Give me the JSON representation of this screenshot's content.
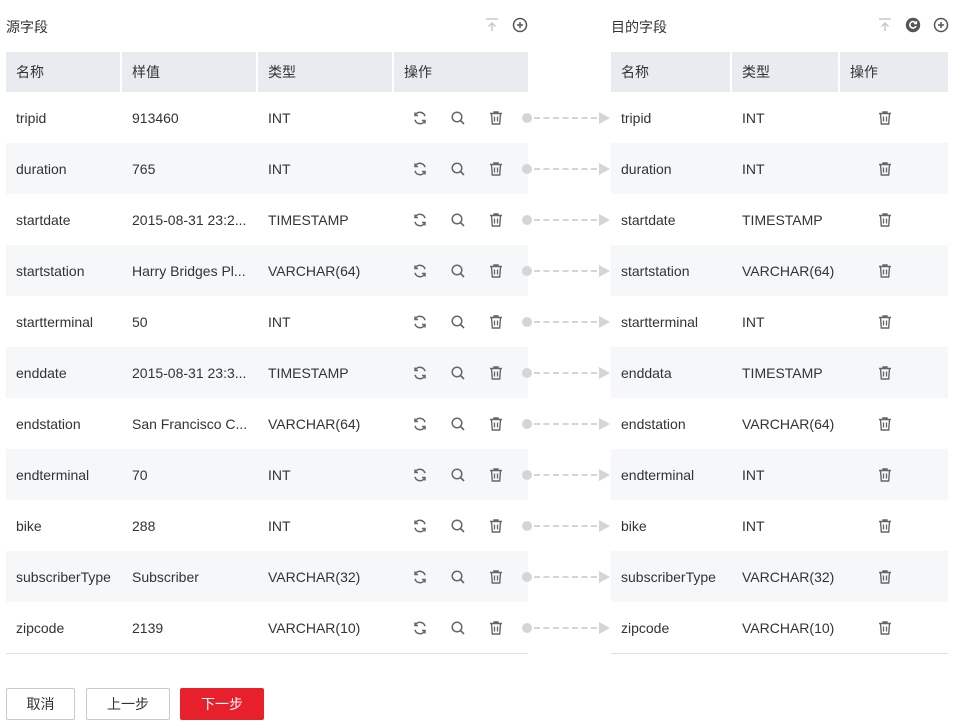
{
  "source": {
    "title": "源字段",
    "columns": [
      "名称",
      "样值",
      "类型",
      "操作"
    ],
    "rows": [
      {
        "name": "tripid",
        "sample": "913460",
        "type": "INT"
      },
      {
        "name": "duration",
        "sample": "765",
        "type": "INT"
      },
      {
        "name": "startdate",
        "sample": "2015-08-31 23:2...",
        "type": "TIMESTAMP"
      },
      {
        "name": "startstation",
        "sample": "Harry Bridges Pl...",
        "type": "VARCHAR(64)"
      },
      {
        "name": "startterminal",
        "sample": "50",
        "type": "INT"
      },
      {
        "name": "enddate",
        "sample": "2015-08-31 23:3...",
        "type": "TIMESTAMP"
      },
      {
        "name": "endstation",
        "sample": "San Francisco C...",
        "type": "VARCHAR(64)"
      },
      {
        "name": "endterminal",
        "sample": "70",
        "type": "INT"
      },
      {
        "name": "bike",
        "sample": "288",
        "type": "INT"
      },
      {
        "name": "subscriberType",
        "sample": "Subscriber",
        "type": "VARCHAR(32)"
      },
      {
        "name": "zipcode",
        "sample": "2139",
        "type": "VARCHAR(10)"
      }
    ],
    "header_icons": [
      "move-top-icon",
      "add-circle-icon"
    ],
    "row_actions": [
      "convert-icon",
      "search-icon",
      "delete-icon"
    ]
  },
  "target": {
    "title": "目的字段",
    "columns": [
      "名称",
      "类型",
      "操作"
    ],
    "rows": [
      {
        "name": "tripid",
        "type": "INT"
      },
      {
        "name": "duration",
        "type": "INT"
      },
      {
        "name": "startdate",
        "type": "TIMESTAMP"
      },
      {
        "name": "startstation",
        "type": "VARCHAR(64)"
      },
      {
        "name": "startterminal",
        "type": "INT"
      },
      {
        "name": "enddata",
        "type": "TIMESTAMP"
      },
      {
        "name": "endstation",
        "type": "VARCHAR(64)"
      },
      {
        "name": "endterminal",
        "type": "INT"
      },
      {
        "name": "bike",
        "type": "INT"
      },
      {
        "name": "subscriberType",
        "type": "VARCHAR(32)"
      },
      {
        "name": "zipcode",
        "type": "VARCHAR(10)"
      }
    ],
    "header_icons": [
      "move-top-icon",
      "refresh-icon",
      "add-circle-icon"
    ],
    "row_actions": [
      "delete-icon"
    ]
  },
  "footer": {
    "cancel_label": "取消",
    "prev_label": "上一步",
    "next_label": "下一步"
  },
  "colors": {
    "header_bg": "#e8ebef",
    "alt_row_bg": "#f5f7f9",
    "primary": "#e8202c",
    "icon": "#666666",
    "connector": "#d5d5d5"
  }
}
